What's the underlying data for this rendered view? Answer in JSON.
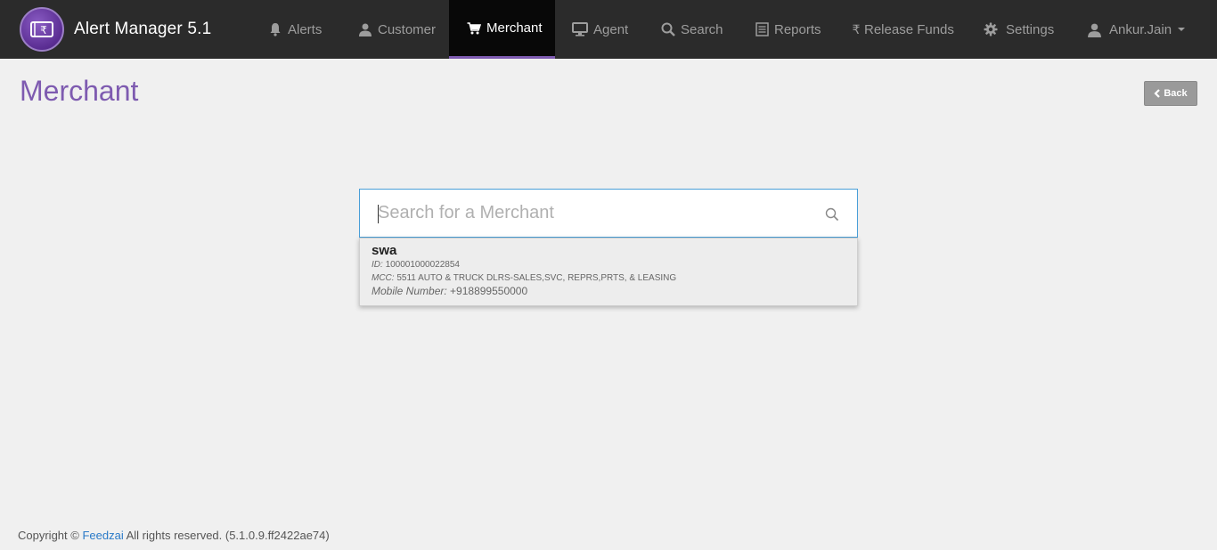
{
  "app": {
    "title": "Alert Manager 5.1",
    "logo_icon": "rupee-card-icon",
    "logo_color": "#6b3aa6"
  },
  "nav": {
    "items": [
      {
        "label": "Alerts",
        "icon": "bell-icon"
      },
      {
        "label": "Customer",
        "icon": "user-icon"
      },
      {
        "label": "Merchant",
        "icon": "cart-icon",
        "active": true
      },
      {
        "label": "Agent",
        "icon": "monitor-icon"
      },
      {
        "label": "Search",
        "icon": "search-icon"
      },
      {
        "label": "Reports",
        "icon": "list-icon"
      },
      {
        "label": "Release Funds",
        "icon": "rupee-icon"
      },
      {
        "label": "Settings",
        "icon": "gear-icon"
      }
    ],
    "user": {
      "label": "Ankur.Jain",
      "icon": "user-icon"
    }
  },
  "page": {
    "title": "Merchant",
    "back_label": "Back"
  },
  "search": {
    "placeholder": "Search for a Merchant",
    "value": ""
  },
  "result": {
    "name": "swa",
    "id_label": "ID:",
    "id_value": "100001000022854",
    "mcc_label": "MCC:",
    "mcc_value": "5511 AUTO & TRUCK DLRS-SALES,SVC, REPRS,PRTS, & LEASING",
    "mobile_label": "Mobile Number:",
    "mobile_value": "+918899550000"
  },
  "footer": {
    "prefix": "Copyright ©",
    "link": "Feedzai",
    "suffix": "All rights reserved. (5.1.0.9.ff2422ae74)"
  },
  "colors": {
    "navbar": "#2b2b2b",
    "accent": "#7e5bb0",
    "link": "#2a7ac8"
  }
}
